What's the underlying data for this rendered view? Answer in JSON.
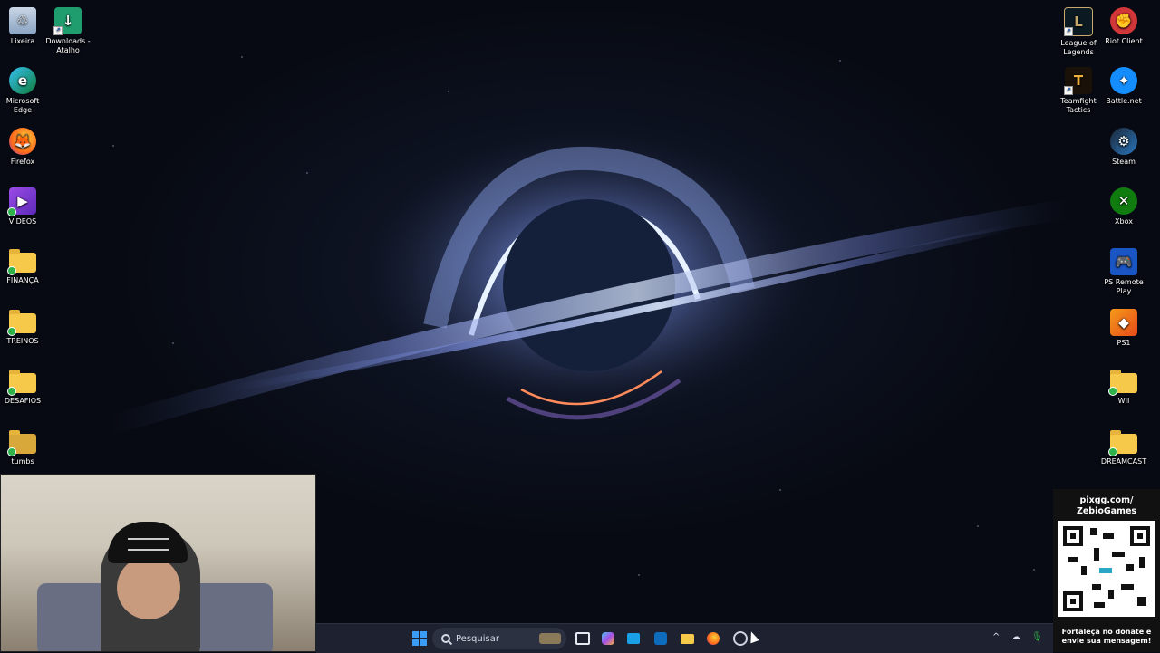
{
  "desktop_left": [
    {
      "label": "Lixeira",
      "icon": "recycle-bin-icon"
    },
    {
      "label": "Downloads - Atalho",
      "icon": "download-shortcut-icon"
    },
    {
      "label": "Microsoft Edge",
      "icon": "edge-icon"
    },
    {
      "label": "Firefox",
      "icon": "firefox-icon"
    },
    {
      "label": "VIDEOS",
      "icon": "videos-icon"
    },
    {
      "label": "FINANÇA",
      "icon": "folder-icon"
    },
    {
      "label": "TREINOS",
      "icon": "folder-icon"
    },
    {
      "label": "DESAFIOS",
      "icon": "folder-icon"
    },
    {
      "label": "tumbs",
      "icon": "folder-icon"
    }
  ],
  "desktop_right": [
    {
      "label": "League of Legends",
      "icon": "league-of-legends-icon"
    },
    {
      "label": "Riot Client",
      "icon": "riot-client-icon"
    },
    {
      "label": "Teamfight Tactics",
      "icon": "teamfight-tactics-icon"
    },
    {
      "label": "Battle.net",
      "icon": "battlenet-icon"
    },
    {
      "label": "Steam",
      "icon": "steam-icon"
    },
    {
      "label": "Xbox",
      "icon": "xbox-icon"
    },
    {
      "label": "PS Remote Play",
      "icon": "ps-remote-play-icon"
    },
    {
      "label": "PS1",
      "icon": "ps1-icon"
    },
    {
      "label": "WII",
      "icon": "folder-icon"
    },
    {
      "label": "DREAMCAST",
      "icon": "folder-icon"
    }
  ],
  "donate": {
    "url_line1": "pixgg.com/",
    "url_line2": "ZebioGames",
    "msg_line1": "Fortaleça no donate e",
    "msg_line2": "envie sua mensagem!"
  },
  "taskbar": {
    "search_placeholder": "Pesquisar",
    "apps": [
      "task-view-icon",
      "copilot-icon",
      "store-icon",
      "outlook-icon",
      "file-explorer-icon",
      "firefox-icon",
      "obs-icon"
    ]
  },
  "colors": {
    "taskbar": "#1e2230",
    "accent": "#3a78ff"
  }
}
